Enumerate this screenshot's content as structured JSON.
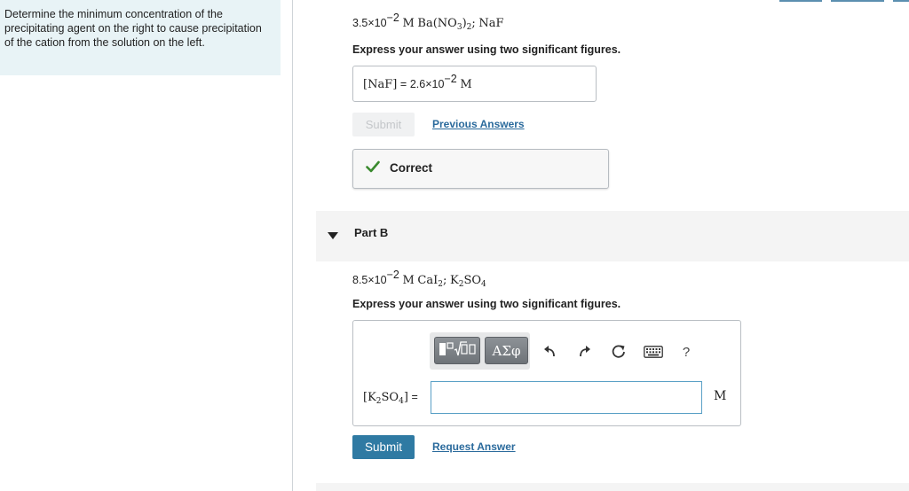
{
  "question": {
    "text": "Determine the minimum concentration of the precipitating agent on the right to cause precipitation of the cation from the solution on the left."
  },
  "part_a": {
    "formula": {
      "coef": "3.5×10",
      "exp": "−2",
      "unit": "M",
      "salt_pre": "Ba(NO",
      "salt_sub": "3",
      "salt_post": ")",
      "salt_sub2": "2",
      "sep": ";",
      "agent": "NaF"
    },
    "instruction": "Express your answer using two significant figures.",
    "answer": {
      "label": "[NaF]",
      "equals": "=",
      "coef": "2.6×10",
      "exp": "−2",
      "unit": "M"
    },
    "submit_label": "Submit",
    "previous_answers_label": "Previous Answers",
    "feedback": "Correct",
    "colors": {
      "check": "#3a8a2e"
    }
  },
  "part_b": {
    "header": "Part B",
    "formula": {
      "coef": "8.5×10",
      "exp": "−2",
      "unit": "M",
      "salt_pre": "CaI",
      "salt_sub": "2",
      "sep": ";",
      "agent_pre": "K",
      "agent_sub": "2",
      "agent_mid": "SO",
      "agent_sub2": "4"
    },
    "instruction": "Express your answer using two significant figures.",
    "input_label": {
      "pre": "[K",
      "sub": "2",
      "mid": "SO",
      "sub2": "4",
      "post": "]",
      "equals": "="
    },
    "input_value": "",
    "unit": "M",
    "toolbar": {
      "greek_label": "ΑΣφ",
      "help_label": "?"
    },
    "submit_label": "Submit",
    "request_answer_label": "Request Answer"
  }
}
